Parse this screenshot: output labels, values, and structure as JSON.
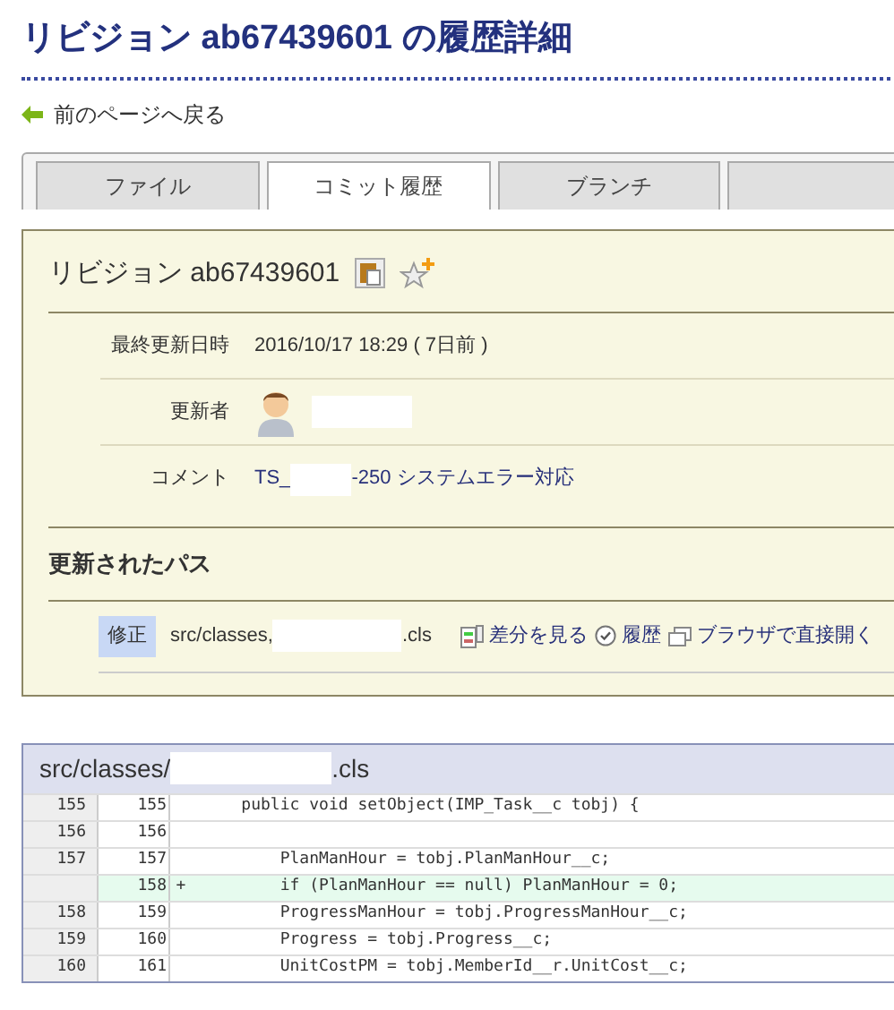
{
  "page_title": "リビジョン ab67439601 の履歴詳細",
  "back_link": "前のページへ戻る",
  "tabs": [
    {
      "label": "ファイル",
      "selected": false
    },
    {
      "label": "コミット履歴",
      "selected": true
    },
    {
      "label": "ブランチ",
      "selected": false
    },
    {
      "selected": false
    }
  ],
  "revision": {
    "title": "リビジョン ab67439601",
    "fields": [
      {
        "kind": "text",
        "label": "最終更新日時",
        "value": "2016/10/17 18:29 ( 7日前 )"
      },
      {
        "kind": "user",
        "label": "更新者"
      },
      {
        "kind": "comment",
        "label": "コメント",
        "prefix": "TS_",
        "suffix": "-250 システムエラー対応"
      }
    ]
  },
  "updated_paths": {
    "heading": "更新されたパス",
    "items": [
      {
        "change": "修正",
        "path_prefix": "src/classes,",
        "path_suffix": ".cls",
        "actions": [
          {
            "kind": "diff",
            "label": "差分を見る"
          },
          {
            "kind": "history",
            "label": "履歴"
          },
          {
            "kind": "browser",
            "label": "ブラウザで直接開く"
          }
        ]
      }
    ]
  },
  "diff": {
    "file_prefix": "src/classes/",
    "file_suffix": ".cls",
    "lines": [
      {
        "old": "155",
        "new": "155",
        "added": false,
        "code": "    public void setObject(IMP_Task__c tobj) {"
      },
      {
        "old": "156",
        "new": "156",
        "added": false
      },
      {
        "old": "157",
        "new": "157",
        "added": false,
        "code": "        PlanManHour = tobj.PlanManHour__c;"
      },
      {
        "new": "158",
        "added": true,
        "mark": "+",
        "code": "        if (PlanManHour == null) PlanManHour = 0;"
      },
      {
        "old": "158",
        "new": "159",
        "added": false,
        "code": "        ProgressManHour = tobj.ProgressManHour__c;"
      },
      {
        "old": "159",
        "new": "160",
        "added": false,
        "code": "        Progress = tobj.Progress__c;"
      },
      {
        "old": "160",
        "new": "161",
        "added": false,
        "code": "        UnitCostPM = tobj.MemberId__r.UnitCost__c;"
      }
    ]
  }
}
